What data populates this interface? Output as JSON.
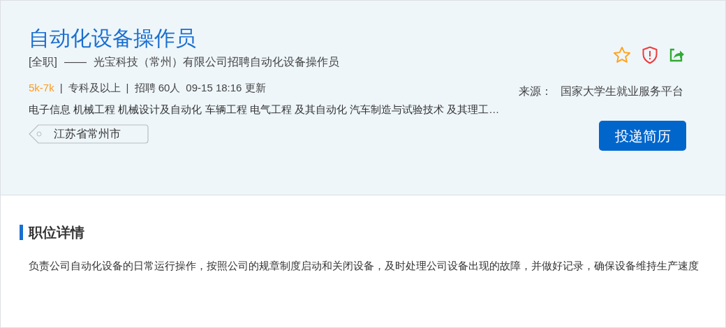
{
  "job": {
    "title": "自动化设备操作员",
    "type": "[全职]",
    "dash": "——",
    "company_line": "光宝科技（常州）有限公司招聘自动化设备操作员",
    "salary": "5k-7k",
    "education": "专科及以上",
    "headcount": "招聘 60人",
    "updated": "09-15 18:16 更新",
    "separator": "|",
    "majors": "电子信息 机械工程 机械设计及自动化 车辆工程 电气工程 及其自动化 汽车制造与试验技术 及其理工…",
    "location": "江苏省常州市",
    "source_label": "来源：",
    "source": "国家大学生就业服务平台",
    "apply_button": "投递简历",
    "favorited": false
  },
  "details": {
    "heading": "职位详情",
    "description": "负责公司自动化设备的日常运行操作，按照公司的规章制度启动和关闭设备，及时处理公司设备出现的故障，并做好记录，确保设备维持生产速度"
  }
}
